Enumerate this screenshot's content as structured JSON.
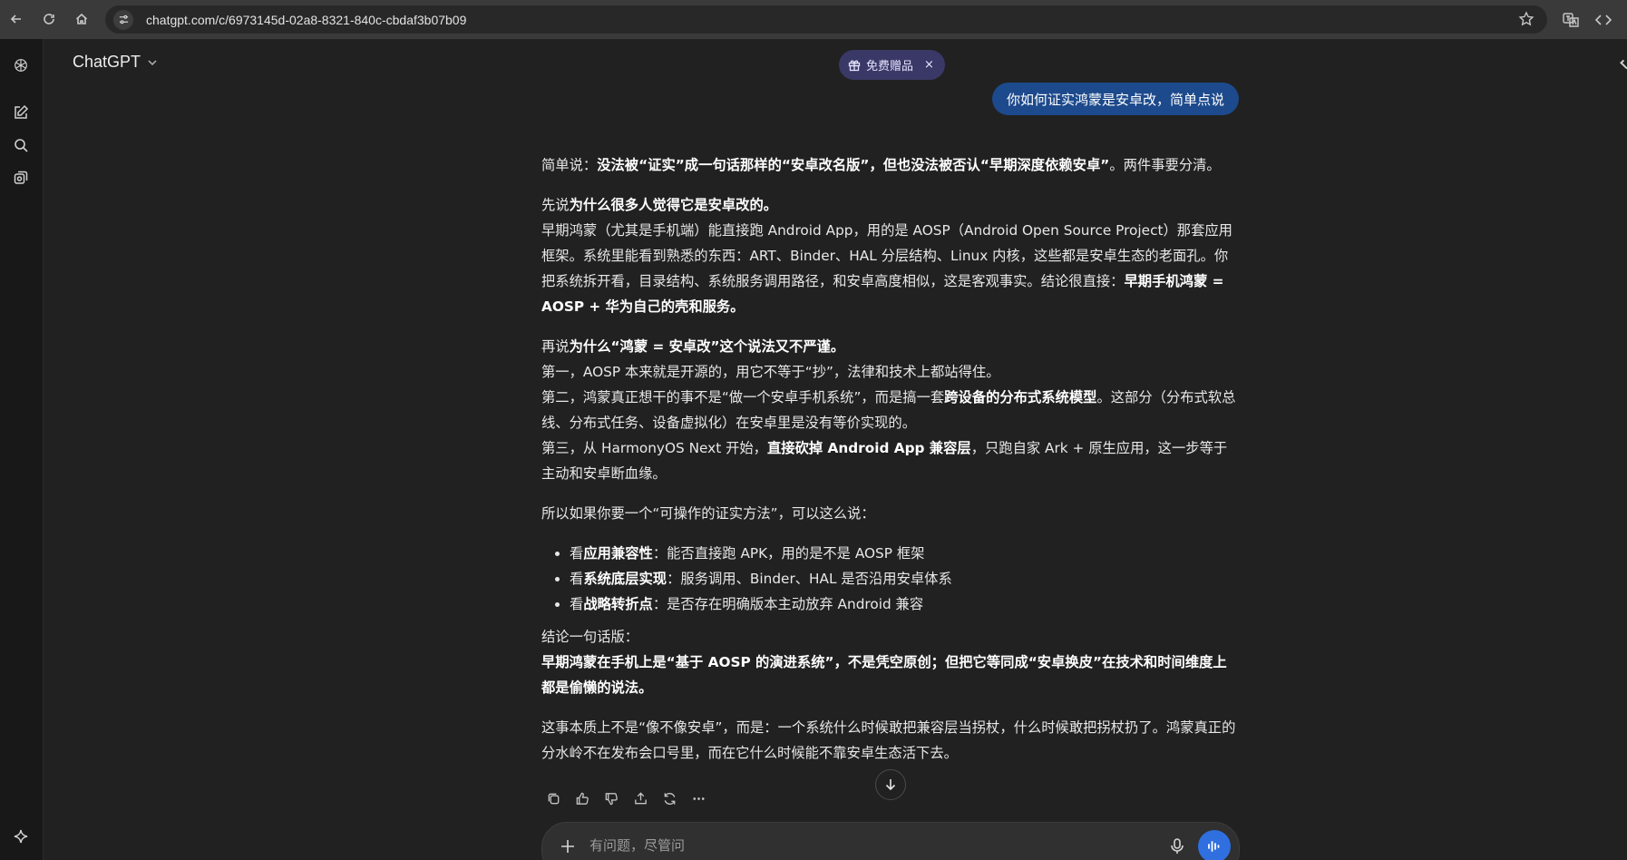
{
  "browser": {
    "url": "chatgpt.com/c/6973145d-02a8-8321-840c-cbdaf3b07b09",
    "icons": [
      "back-icon",
      "reload-icon",
      "home-icon",
      "site-info-icon",
      "star-icon",
      "translate-icon",
      "code-icon"
    ]
  },
  "header": {
    "model_name": "ChatGPT",
    "promo_label": "免费赠品",
    "promo_close": "×"
  },
  "sidebar": {
    "icons": [
      "openai-logo-icon",
      "new-chat-icon",
      "search-icon",
      "library-icon",
      "sparkle-icon"
    ]
  },
  "conversation": {
    "user_message": "你如何证实鸿蒙是安卓改，简单点说",
    "answer": {
      "p1_prefix": "简单说：",
      "p1_bold": "没法被“证实”成一句话那样的“安卓改名版”，但也没法被否认“早期深度依赖安卓”",
      "p1_suffix": "。两件事要分清。",
      "p2_prefix": "先说",
      "p2_bold": "为什么很多人觉得它是安卓改的。",
      "p2_body": "早期鸿蒙（尤其是手机端）能直接跑 Android App，用的是 AOSP（Android Open Source Project）那套应用框架。系统里能看到熟悉的东西：ART、Binder、HAL 分层结构、Linux 内核，这些都是安卓生态的老面孔。你把系统拆开看，目录结构、系统服务调用路径，和安卓高度相似，这是客观事实。结论很直接：",
      "p2_bold_end": "早期手机鸿蒙 = AOSP + 华为自己的壳和服务。",
      "p3_prefix": "再说",
      "p3_bold": "为什么“鸿蒙 = 安卓改”这个说法又不严谨。",
      "p3_line1": "第一，AOSP 本来就是开源的，用它不等于“抄”，法律和技术上都站得住。",
      "p3_line2_prefix": "第二，鸿蒙真正想干的事不是“做一个安卓手机系统”，而是搞一套",
      "p3_line2_bold": "跨设备的分布式系统模型",
      "p3_line2_suffix": "。这部分（分布式软总线、分布式任务、设备虚拟化）在安卓里是没有等价实现的。",
      "p3_line3_prefix": "第三，从 HarmonyOS Next 开始，",
      "p3_line3_bold": "直接砍掉 Android App 兼容层",
      "p3_line3_suffix": "，只跑自家 Ark + 原生应用，这一步等于主动和安卓断血缘。",
      "p4": "所以如果你要一个“可操作的证实方法”，可以这么说：",
      "bullets": [
        {
          "prefix": "看",
          "bold": "应用兼容性",
          "suffix": "：能否直接跑 APK，用的是不是 AOSP 框架"
        },
        {
          "prefix": "看",
          "bold": "系统底层实现",
          "suffix": "：服务调用、Binder、HAL 是否沿用安卓体系"
        },
        {
          "prefix": "看",
          "bold": "战略转折点",
          "suffix": "：是否存在明确版本主动放弃 Android 兼容"
        }
      ],
      "conclusion_label": "结论一句话版：",
      "conclusion_bold": "早期鸿蒙在手机上是“基于 AOSP 的演进系统”，不是凭空原创；但把它等同成“安卓换皮”在技术和时间维度上都是偷懒的说法。",
      "p_last": "这事本质上不是“像不像安卓”，而是：一个系统什么时候敢把兼容层当拐杖，什么时候敢把拐杖扔了。鸿蒙真正的分水岭不在发布会口号里，而在它什么时候能不靠安卓生态活下去。"
    },
    "action_icons": [
      "copy-icon",
      "thumbs-up-icon",
      "thumbs-down-icon",
      "share-icon",
      "regenerate-icon",
      "more-icon"
    ]
  },
  "composer": {
    "placeholder": "有问题，尽管问"
  }
}
